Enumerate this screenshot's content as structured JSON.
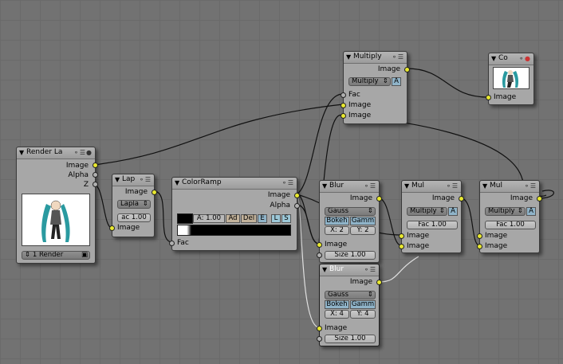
{
  "nodes": {
    "render_layers": {
      "title": "Render La",
      "outputs": [
        "Image",
        "Alpha",
        "Z"
      ],
      "scene_select": "1 Render"
    },
    "laplace": {
      "title": "Lap",
      "output": "Image",
      "filter_type": "Lapla",
      "fac_value": "ac 1.00",
      "input": "Image"
    },
    "color_ramp": {
      "title": "ColorRamp",
      "outputs": [
        "Image",
        "Alpha"
      ],
      "alpha_field": "A: 1.00",
      "buttons": [
        "Ad",
        "Del",
        "E",
        "L",
        "S"
      ],
      "input": "Fac"
    },
    "blur1": {
      "title": "Blur",
      "output": "Image",
      "filter_type": "Gauss",
      "bokeh_label": "Bokeh",
      "gamma_label": "Gamm",
      "x_value": "X: 2",
      "y_value": "Y: 2",
      "input": "Image",
      "size_value": "Size 1.00"
    },
    "blur2": {
      "title": "Blur",
      "output": "Image",
      "filter_type": "Gauss",
      "bokeh_label": "Bokeh",
      "gamma_label": "Gamm",
      "x_value": "X: 4",
      "y_value": "Y: 4",
      "input": "Image",
      "size_value": "Size 1.00"
    },
    "multiply_top": {
      "title": "Multiply",
      "output": "Image",
      "blend_mode": "Multiply",
      "alpha_btn": "A",
      "inputs": [
        "Fac",
        "Image",
        "Image"
      ]
    },
    "mul1": {
      "title": "Mul",
      "output": "Image",
      "blend_mode": "Multiply",
      "alpha_btn": "A",
      "fac_value": "Fac 1.00",
      "inputs": [
        "Image",
        "Image"
      ]
    },
    "mul2": {
      "title": "Mul",
      "output": "Image",
      "blend_mode": "Multiply",
      "alpha_btn": "A",
      "fac_value": "Fac 1.00",
      "inputs": [
        "Image",
        "Image"
      ]
    },
    "composite": {
      "title": "Co",
      "input": "Image"
    }
  },
  "colors": {
    "background": "#727272",
    "node_body": "#a7a7a7",
    "socket_image": "#e8e830",
    "socket_value": "#b0b0b0",
    "wire": "#111111",
    "wire_highlight": "#e0e0e0"
  }
}
